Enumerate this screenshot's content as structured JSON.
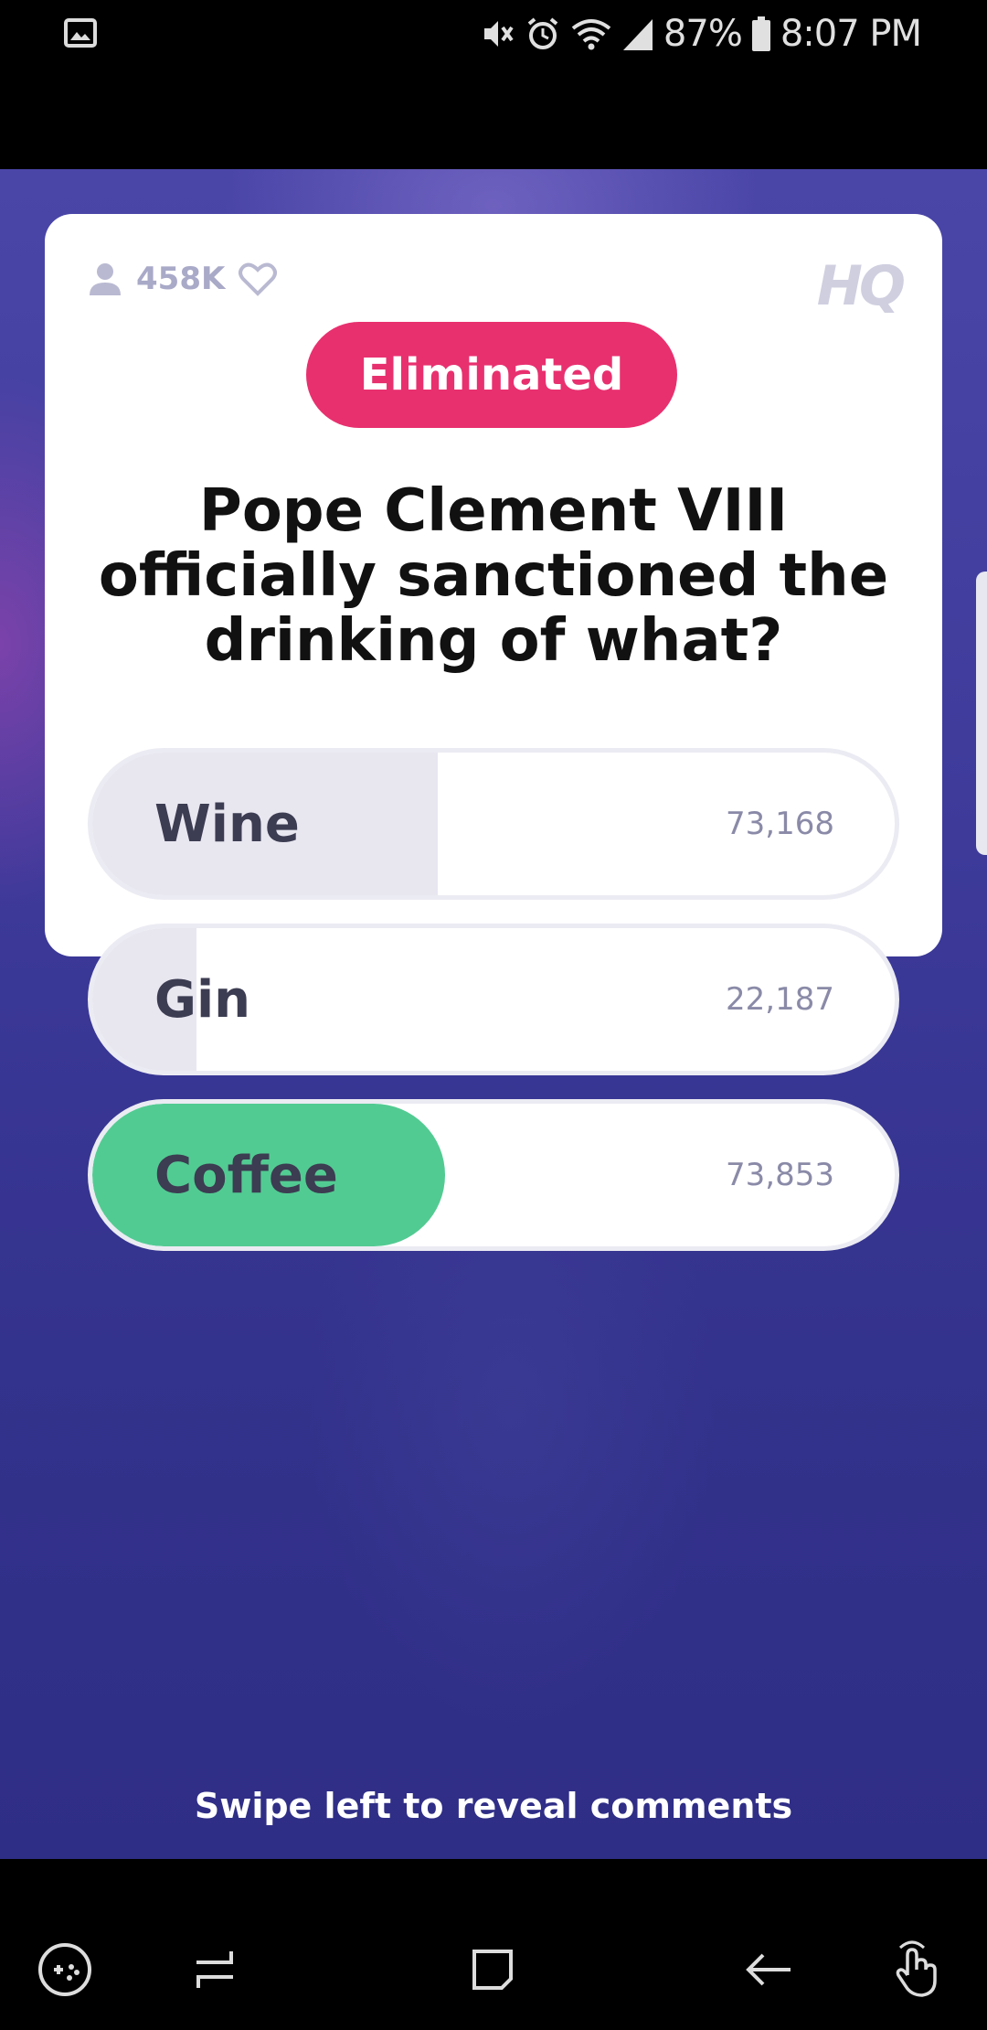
{
  "status_bar": {
    "battery_percent": "87%",
    "time": "8:07 PM",
    "icons": [
      "gallery-icon",
      "mute-icon",
      "alarm-icon",
      "wifi-icon",
      "signal-icon",
      "battery-icon"
    ]
  },
  "card": {
    "viewer_count": "458K",
    "logo": "HQ",
    "status_badge": "Eliminated",
    "question": "Pope Clement VIII officially sanctioned the drinking of what?",
    "answers": [
      {
        "label": "Wine",
        "count": "73,168",
        "fill_fraction": 0.43,
        "correct": false
      },
      {
        "label": "Gin",
        "count": "22,187",
        "fill_fraction": 0.13,
        "correct": false
      },
      {
        "label": "Coffee",
        "count": "73,853",
        "fill_fraction": 0.44,
        "correct": true
      }
    ]
  },
  "swipe_hint": "Swipe left to reveal comments",
  "colors": {
    "eliminated": "#e8306f",
    "correct": "#52cb92",
    "background": "#3d3a9a"
  },
  "nav_bar": {
    "buttons": [
      "game-tools-icon",
      "recent-apps-icon",
      "home-icon",
      "back-icon",
      "touch-gesture-icon"
    ]
  }
}
